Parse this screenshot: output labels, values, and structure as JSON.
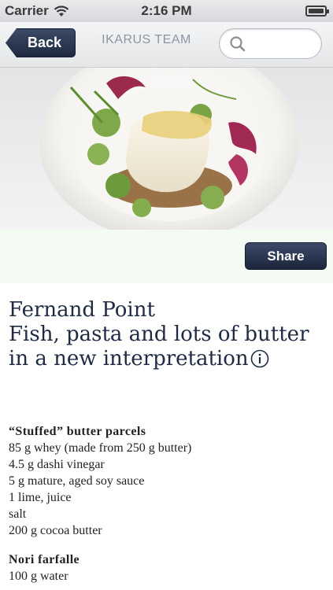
{
  "status_bar": {
    "carrier": "Carrier",
    "time": "2:16 PM"
  },
  "nav": {
    "back_label": "Back",
    "title": "IKARUS TEAM",
    "search_placeholder": ""
  },
  "share": {
    "label": "Share"
  },
  "article": {
    "title_lines": [
      "Fernand Point",
      "Fish, pasta and lots of butter",
      "in a new interpretation"
    ]
  },
  "recipe_sections": [
    {
      "heading": "“Stuffed” butter parcels",
      "items": [
        "85 g whey (made from 250 g butter)",
        "4.5 g dashi vinegar",
        "5 g mature, aged soy sauce",
        "1 lime, juice",
        "salt",
        "200 g cocoa butter"
      ]
    },
    {
      "heading": "Nori farfalle",
      "items": [
        "100 g water"
      ]
    }
  ],
  "colors": {
    "nav_button": "#2a3652",
    "title_text": "#1f2a44",
    "share_strip": "#f3fbf3"
  },
  "icons": [
    "wifi-icon",
    "battery-icon",
    "search-icon",
    "info-icon"
  ]
}
